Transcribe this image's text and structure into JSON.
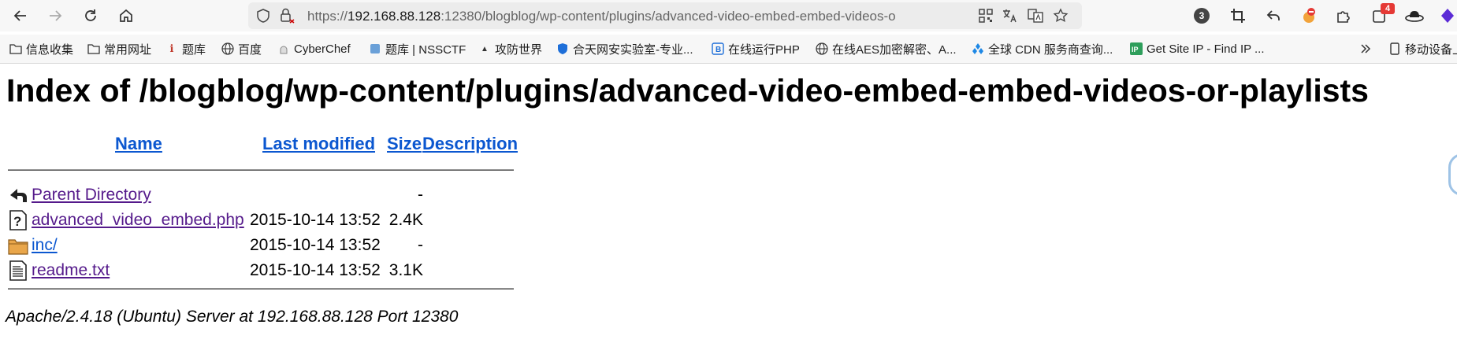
{
  "browser": {
    "url_prefix": "https://",
    "url_host": "192.168.88.128",
    "url_rest": ":12380/blogblog/wp-content/plugins/advanced-video-embed-embed-videos-o",
    "extension_badge_count": "3",
    "notification_badge_count": "4"
  },
  "bookmarks": [
    {
      "label": "信息收集",
      "icon": "folder-icon"
    },
    {
      "label": "常用网址",
      "icon": "folder-icon"
    },
    {
      "label": "题库",
      "icon": "site-icon"
    },
    {
      "label": "百度",
      "icon": "globe-icon"
    },
    {
      "label": "CyberChef",
      "icon": "chef-icon"
    },
    {
      "label": "题库 | NSSCTF",
      "icon": "nssctf-icon"
    },
    {
      "label": "攻防世界",
      "icon": "site-icon"
    },
    {
      "label": "合天网安实验室-专业...",
      "icon": "shield-icon"
    },
    {
      "label": "在线运行PHP",
      "icon": "b-icon"
    },
    {
      "label": "在线AES加密解密、A...",
      "icon": "globe-icon"
    },
    {
      "label": "全球 CDN 服务商查询...",
      "icon": "cdn-icon"
    },
    {
      "label": "Get Site IP - Find IP ...",
      "icon": "ip-icon"
    }
  ],
  "mobile_bookmarks_label": "移动设备上",
  "page": {
    "title": "Index of /blogblog/wp-content/plugins/advanced-video-embed-embed-videos-or-playlists",
    "columns": {
      "name": "Name",
      "last_modified": "Last modified",
      "size": "Size",
      "description": "Description"
    },
    "rows": [
      {
        "name": "Parent Directory",
        "date": "",
        "size": "-",
        "icon": "back-icon"
      },
      {
        "name": "advanced_video_embed.php",
        "date": "2015-10-14 13:52",
        "size": "2.4K",
        "icon": "unknown-file-icon"
      },
      {
        "name": "inc/",
        "date": "2015-10-14 13:52",
        "size": "-",
        "icon": "folder-icon"
      },
      {
        "name": "readme.txt",
        "date": "2015-10-14 13:52",
        "size": "3.1K",
        "icon": "text-file-icon"
      }
    ],
    "footer": "Apache/2.4.18 (Ubuntu) Server at 192.168.88.128 Port 12380"
  }
}
